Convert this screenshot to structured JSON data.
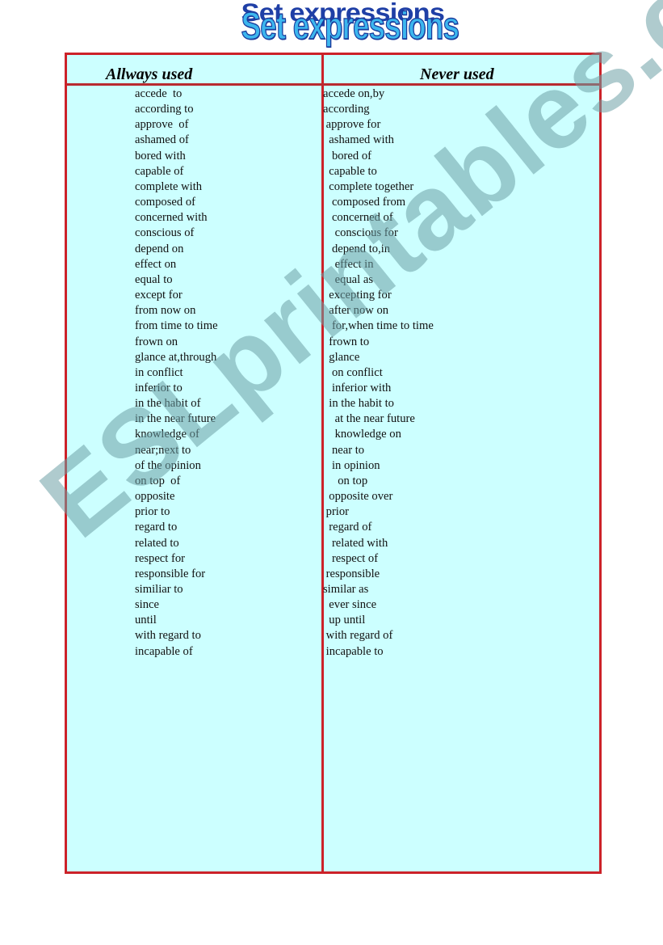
{
  "document": {
    "title": "Set expressions",
    "watermark": "ESLprintables.com",
    "colors": {
      "border": "#cc2229",
      "table_background": "#ccffff",
      "title_fill": "#3cb6ee",
      "title_outline": "#1a3c9c"
    }
  },
  "table": {
    "headers": {
      "left": "Allways  used",
      "right": "Never used"
    },
    "always_used": [
      "accede  to",
      "according to",
      "approve  of",
      "ashamed of",
      "bored with",
      "capable of",
      "complete with",
      "composed of",
      "concerned with",
      "conscious of",
      "depend on",
      "effect on",
      "equal to",
      "except for",
      "from now on",
      "from time to time",
      "frown on",
      "glance at,through",
      "in conflict",
      "inferior to",
      "in the habit of",
      "in the near future",
      "knowledge of",
      "near;next to",
      "of the opinion",
      "on top  of",
      "opposite",
      "prior to",
      "regard to",
      "related to",
      "respect for",
      "responsible for",
      "similiar to",
      "since",
      "until",
      "with regard to",
      "incapable of"
    ],
    "never_used": [
      "accede on,by",
      "according",
      " approve for",
      "  ashamed with",
      "   bored of",
      "  capable to",
      "  complete together",
      "   composed from",
      "   concerned of",
      "    conscious for",
      "   depend to,in",
      "    effect in",
      "    equal as",
      "  excepting for",
      "  after now on",
      "   for,when time to time",
      "  frown to",
      "  glance",
      "   on conflict",
      "   inferior with",
      "  in the habit to",
      "    at the near future",
      "    knowledge on",
      "   near to",
      "   in opinion",
      "     on top",
      "  opposite over",
      " prior",
      "  regard of",
      "   related with",
      "   respect of",
      " responsible",
      "similar as",
      "  ever since",
      "  up until",
      " with regard of",
      " incapable to"
    ]
  }
}
